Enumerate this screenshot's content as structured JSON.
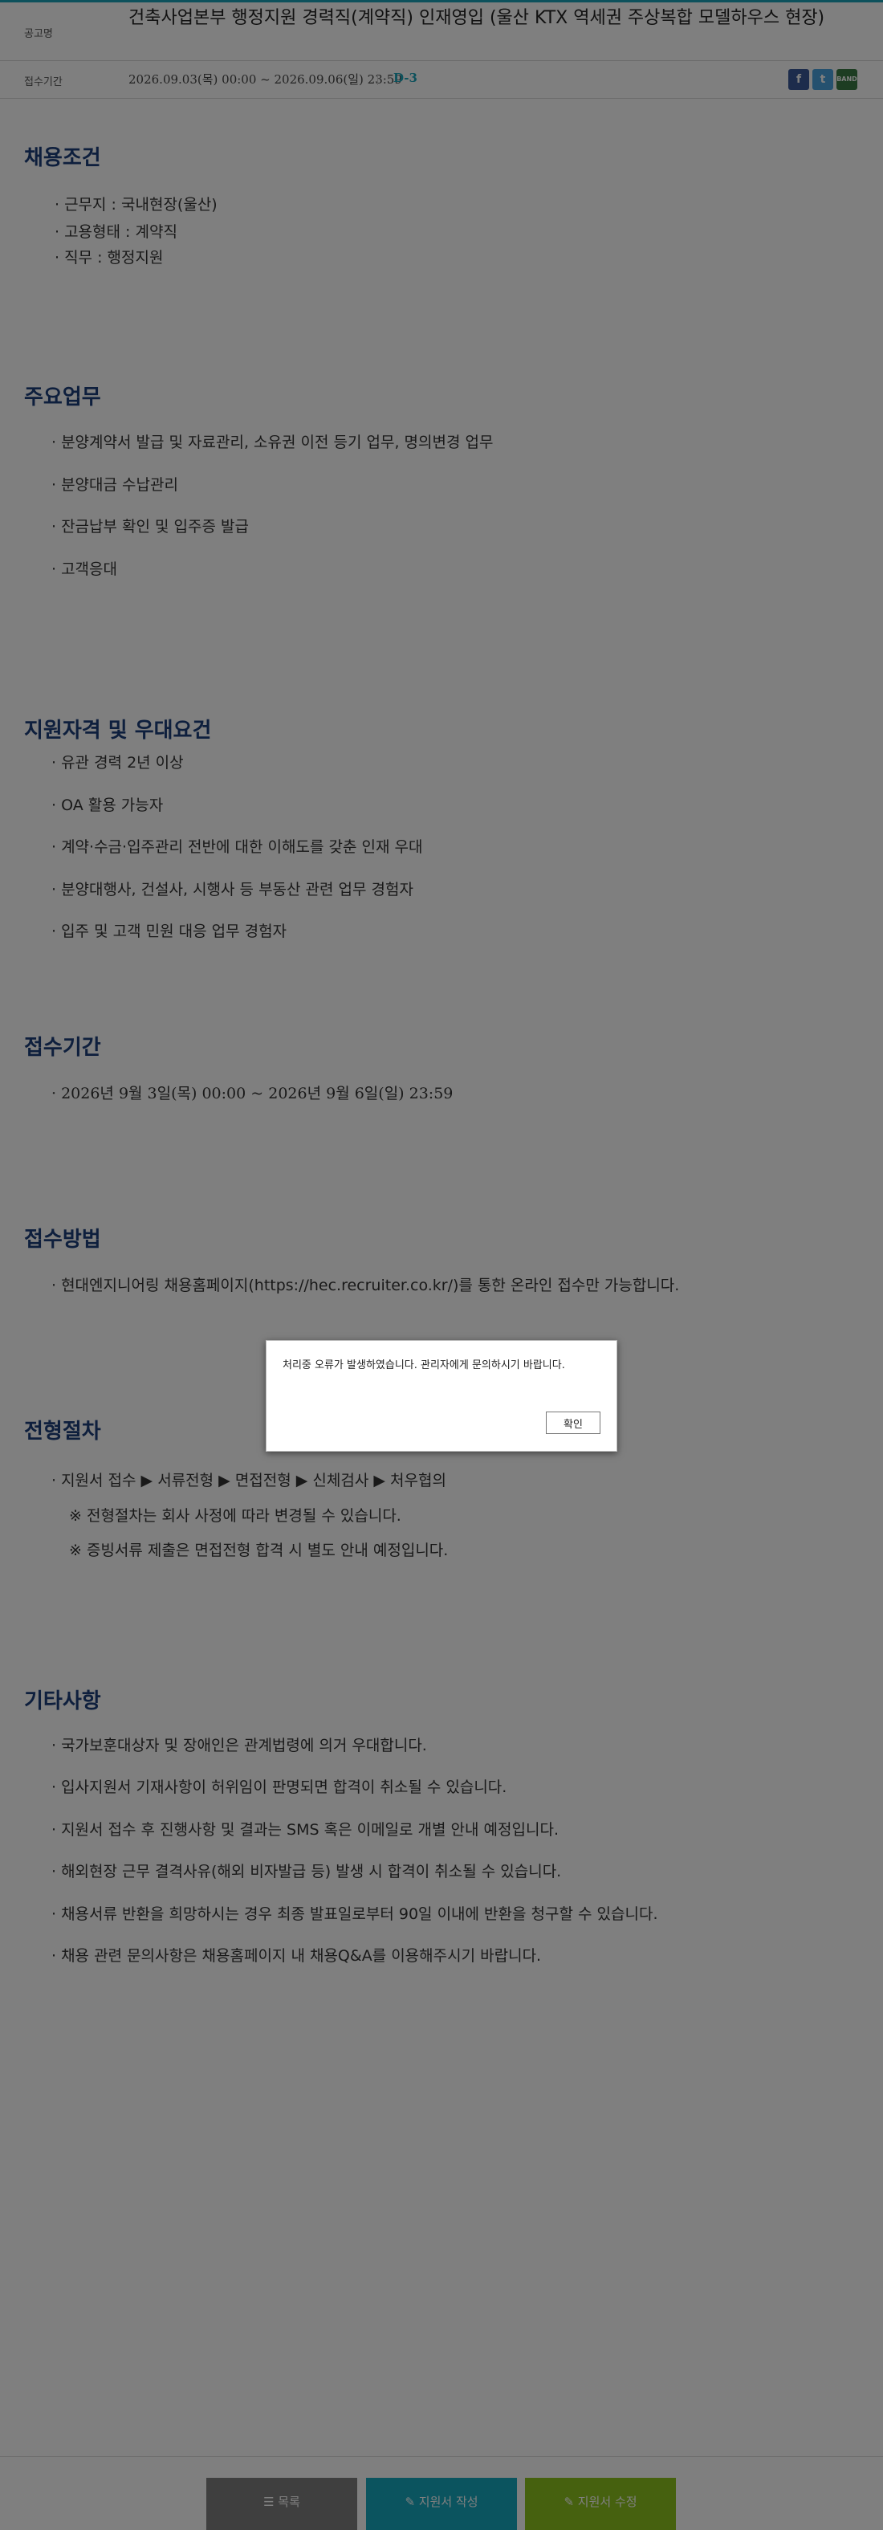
{
  "header": {
    "title_label": "공고명",
    "title": "건축사업본부 행정지원 경력직(계약직) 인재영입 (울산 KTX 역세권 주상복합 모델하우스 현장)",
    "period_label": "접수기간",
    "period": "2026.09.03(목) 00:00 ~ 2026.09.06(일) 23:59",
    "dday": "D-3"
  },
  "sns": {
    "facebook": "f",
    "twitter": "t",
    "band": "BAND"
  },
  "sections": {
    "conditions": {
      "title": "채용조건",
      "items": [
        "· 근무지 : 국내현장(울산)",
        "· 고용형태 : 계약직",
        "· 직무 : 행정지원"
      ]
    },
    "duties": {
      "title": "주요업무",
      "items": [
        "· 분양계약서 발급 및 자료관리, 소유권 이전 등기 업무, 명의변경 업무",
        "· 분양대금 수납관리",
        "· 잔금납부 확인 및 입주증 발급",
        "· 고객응대"
      ]
    },
    "qualifications": {
      "title": "지원자격 및 우대요건",
      "items": [
        "· 유관 경력 2년 이상",
        "· OA 활용 가능자",
        "· 계약·수금·입주관리 전반에 대한 이해도를 갖춘 인재 우대",
        "· 분양대행사, 건설사, 시행사 등 부동산 관련 업무 경험자",
        "· 입주 및 고객 민원 대응 업무 경험자"
      ]
    },
    "period": {
      "title": "접수기간",
      "items": [
        "· 2026년 9월 3일(목) 00:00 ~ 2026년 9월 6일(일) 23:59"
      ]
    },
    "method": {
      "title": "접수방법",
      "items": [
        "· 현대엔지니어링 채용홈페이지(https://hec.recruiter.co.kr/)를 통한 온라인 접수만 가능합니다."
      ]
    },
    "process": {
      "title": "전형절차",
      "items": [
        "· 지원서 접수 ▶ 서류전형 ▶ 면접전형 ▶ 신체검사 ▶ 처우협의",
        "※ 전형절차는 회사 사정에 따라 변경될 수 있습니다.",
        "※ 증빙서류 제출은 면접전형 합격 시 별도 안내 예정입니다."
      ]
    },
    "etc": {
      "title": "기타사항",
      "items": [
        "· 국가보훈대상자 및 장애인은 관계법령에 의거 우대합니다.",
        "· 입사지원서 기재사항이 허위임이 판명되면 합격이 취소될 수 있습니다.",
        "· 지원서 접수 후 진행사항 및 결과는 SMS 혹은 이메일로 개별 안내 예정입니다.",
        "· 해외현장 근무 결격사유(해외 비자발급 등) 발생 시 합격이 취소될 수 있습니다.",
        "· 채용서류 반환을 희망하시는 경우 최종 발표일로부터 90일 이내에 반환을 청구할 수 있습니다.",
        "· 채용 관련 문의사항은 채용홈페이지 내 채용Q&A를 이용해주시기 바랍니다."
      ]
    }
  },
  "footer": {
    "list_label": "☰ 목록",
    "write_label": "✎ 지원서 작성",
    "edit_label": "✎ 지원서 수정"
  },
  "modal": {
    "message": "처리중 오류가 발생하였습니다. 관리자에게 문의하시기 바랍니다.",
    "ok_label": "확인"
  }
}
